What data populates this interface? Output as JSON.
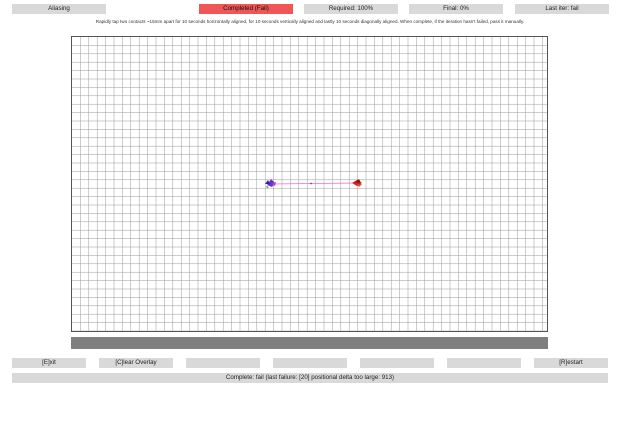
{
  "status": {
    "mode": "Aliasing",
    "result": "Completed (Fail)",
    "required": "Required: 100%",
    "final": "Final: 0%",
    "last_iter": "Last iter: fail"
  },
  "instructions": "Rapidly tap two contacts ~15mm apart for 10 seconds horizontally aligned, for 10 seconds vertically aligned and lastly 10 seconds diagonally aligned. When complete, if the iteration hasn't failed, pass it manually.",
  "buttons": {
    "exit": "[E]xit",
    "clear_overlay": "[C]lear Overlay",
    "blank1": "",
    "blank2": "",
    "blank3": "",
    "blank4": "",
    "restart": "[R]estart"
  },
  "footer": {
    "status": "Complete: fail (last failure: [20] positional delta too large: 913)"
  },
  "colors": {
    "fail": "#f25555",
    "contact_left": "#6a2fd1",
    "contact_right": "#d42020",
    "trace": "#ff66cc"
  }
}
